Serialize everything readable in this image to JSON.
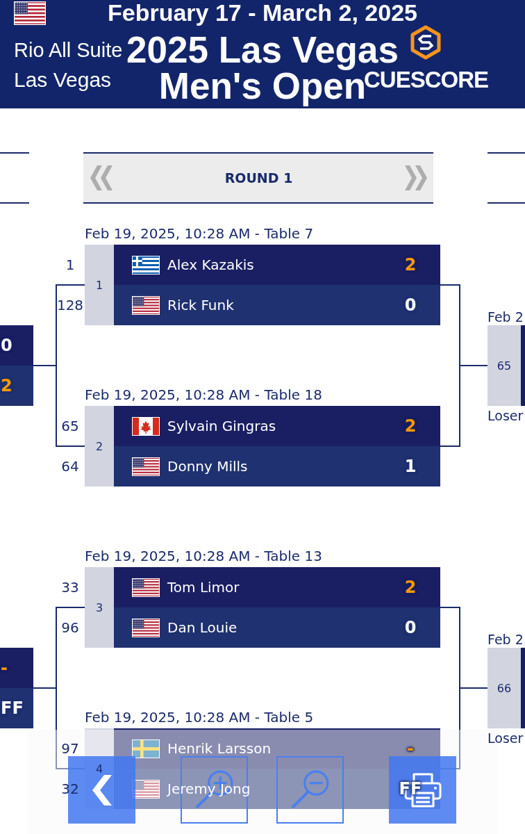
{
  "header": {
    "flag": {
      "kind": "us"
    },
    "dates": "February 17 - March 2, 2025",
    "venue": "Rio All Suite",
    "city": "Las Vegas",
    "title": [
      "2025 Las Vegas",
      "Men's Open"
    ],
    "logo_text": "CUESCORE"
  },
  "round": {
    "title": "ROUND 1"
  },
  "matches": [
    {
      "label": "Feb 19, 2025, 10:28 AM - Table 7",
      "number": "1",
      "players": [
        {
          "seed": "1",
          "kind": "gr",
          "name": "Alex Kazakis",
          "score": "2",
          "winner": true
        },
        {
          "seed": "128",
          "kind": "us",
          "name": "Rick Funk",
          "score": "0",
          "winner": false
        }
      ]
    },
    {
      "label": "Feb 19, 2025, 10:28 AM - Table 18",
      "number": "2",
      "players": [
        {
          "seed": "65",
          "kind": "ca",
          "name": "Sylvain Gingras",
          "score": "2",
          "winner": true
        },
        {
          "seed": "64",
          "kind": "us",
          "name": "Donny Mills",
          "score": "1",
          "winner": false
        }
      ]
    },
    {
      "label": "Feb 19, 2025, 10:28 AM - Table 13",
      "number": "3",
      "players": [
        {
          "seed": "33",
          "kind": "us",
          "name": "Tom Limor",
          "score": "2",
          "winner": true
        },
        {
          "seed": "96",
          "kind": "us",
          "name": "Dan Louie",
          "score": "0",
          "winner": false
        }
      ]
    },
    {
      "label": "Feb 19, 2025, 10:28 AM - Table 5",
      "number": "4",
      "players": [
        {
          "seed": "97",
          "kind": "se",
          "name": "Henrik Larsson",
          "score": "-",
          "winner": true
        },
        {
          "seed": "32",
          "kind": "us",
          "name": "Jeremy Jong",
          "score": "FF",
          "winner": false
        }
      ]
    }
  ],
  "previous_round": {
    "matches": [
      {
        "scores": [
          {
            "score": "0",
            "winner": false
          },
          {
            "score": "2",
            "winner": true
          }
        ]
      },
      {
        "scores": [
          {
            "score": "-",
            "winner": true
          },
          {
            "score": "FF",
            "winner": false
          }
        ]
      }
    ]
  },
  "next_round": {
    "matches": [
      {
        "label": "Feb 2",
        "number": "65",
        "note": "Loser"
      },
      {
        "label": "Feb 2",
        "number": "66",
        "note": "Loser"
      }
    ]
  },
  "toolbar": {
    "buttons": [
      {
        "kind": "back"
      },
      {
        "kind": "zoom_in"
      },
      {
        "kind": "zoom_out"
      },
      {
        "kind": "print"
      }
    ]
  }
}
